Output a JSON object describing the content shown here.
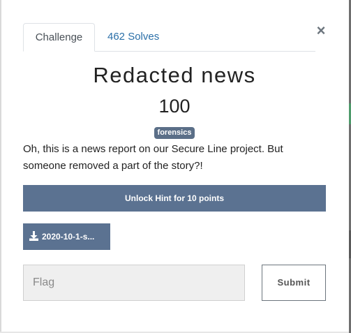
{
  "tabs": {
    "challenge": "Challenge",
    "solves": "462 Solves"
  },
  "close_symbol": "×",
  "challenge": {
    "name": "Redacted news",
    "value": "100",
    "tag": "forensics",
    "description": "Oh, this is a news report on our Secure Line project. But someone removed a part of the story?!",
    "hint_button": "Unlock Hint for 10 points",
    "file_name": "2020-10-1-s..."
  },
  "submission": {
    "flag_placeholder": "Flag",
    "flag_value": "",
    "submit_label": "Submit"
  },
  "icons": {
    "download": "download-icon",
    "close": "close-icon"
  },
  "colors": {
    "button": "#5b7291",
    "tag": "#5b6f88",
    "link": "#2a6fa8"
  }
}
